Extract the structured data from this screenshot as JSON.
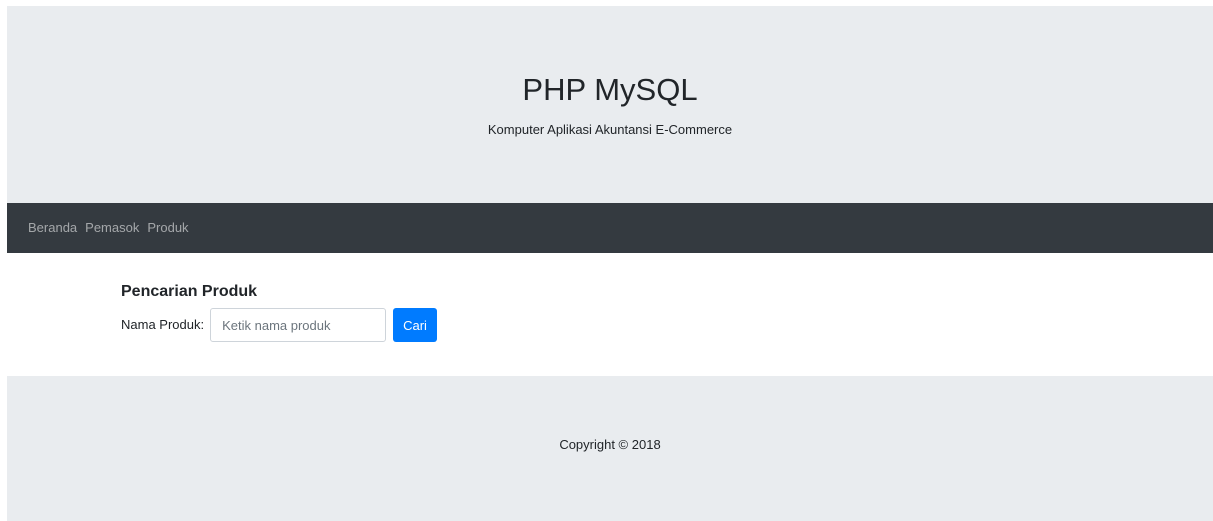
{
  "header": {
    "title": "PHP MySQL",
    "subtitle": "Komputer Aplikasi Akuntansi E-Commerce"
  },
  "nav": {
    "items": [
      {
        "label": "Beranda"
      },
      {
        "label": "Pemasok"
      },
      {
        "label": "Produk"
      }
    ]
  },
  "search": {
    "heading": "Pencarian Produk",
    "label": "Nama Produk:",
    "placeholder": "Ketik nama produk",
    "value": "",
    "button_label": "Cari"
  },
  "footer": {
    "copyright": "Copyright © 2018"
  },
  "colors": {
    "jumbotron_bg": "#e9ecef",
    "navbar_bg": "#343a40",
    "primary_button": "#007bff"
  }
}
